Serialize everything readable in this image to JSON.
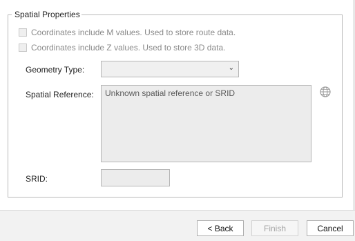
{
  "group": {
    "title": "Spatial Properties"
  },
  "options": {
    "m_values_label": "Coordinates include M values. Used to store route data.",
    "m_values_checked": false,
    "z_values_label": "Coordinates include Z values. Used to store 3D data.",
    "z_values_checked": false
  },
  "geometry": {
    "label": "Geometry Type:",
    "value": ""
  },
  "spatial_reference": {
    "label": "Spatial Reference:",
    "value": "Unknown spatial reference or SRID",
    "icon": "globe-icon"
  },
  "srid": {
    "label": "SRID:",
    "value": ""
  },
  "footer": {
    "back_label": "< Back",
    "finish_label": "Finish",
    "cancel_label": "Cancel"
  }
}
